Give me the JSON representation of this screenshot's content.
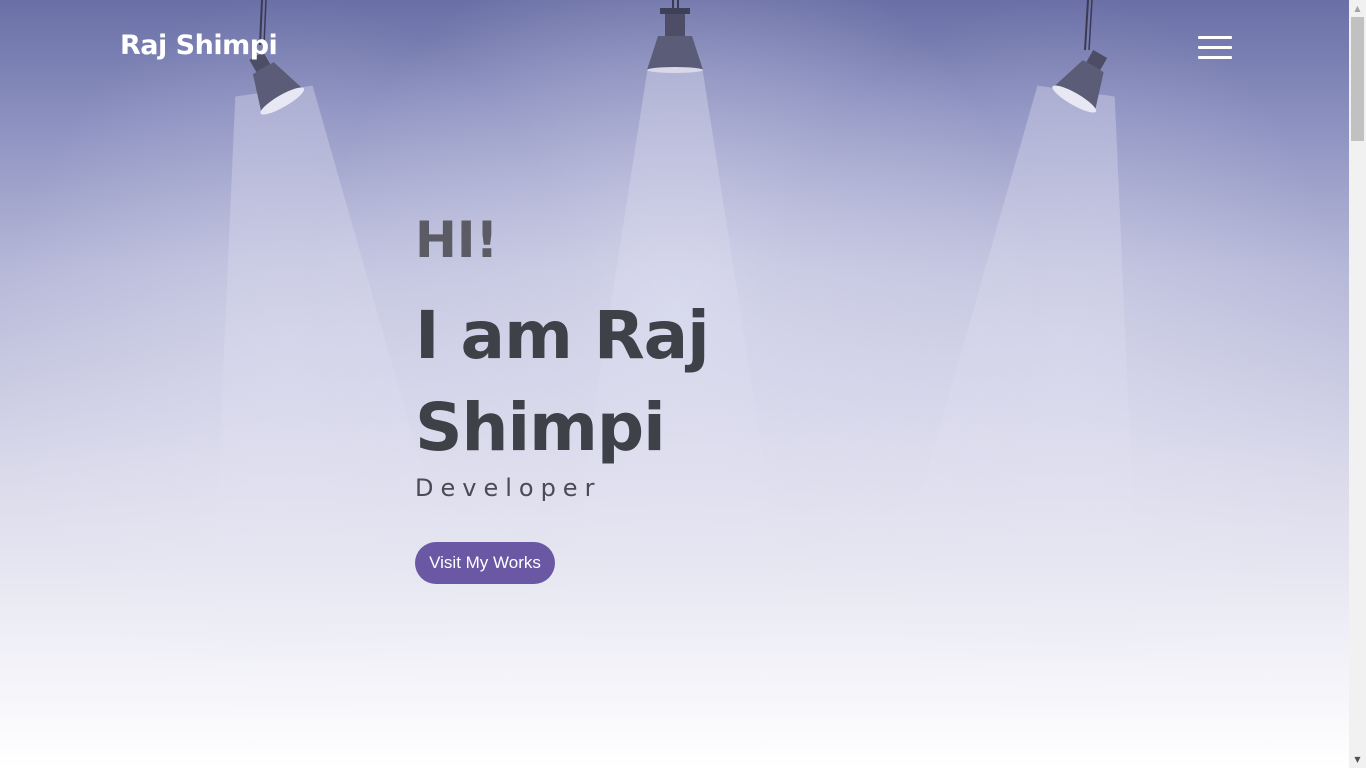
{
  "header": {
    "logo": "Raj Shimpi",
    "menu_icon": "hamburger-menu-icon"
  },
  "hero": {
    "greeting": "HI!",
    "name": "I am Raj Shimpi",
    "role": "Developer",
    "cta_label": "Visit My Works"
  },
  "decor": {
    "lamps": [
      "spotlight-left-icon",
      "spotlight-center-icon",
      "spotlight-right-icon"
    ]
  },
  "colors": {
    "accent": "#6a58a4",
    "heading": "#3f4148",
    "background_top": "#6a6fa6"
  }
}
